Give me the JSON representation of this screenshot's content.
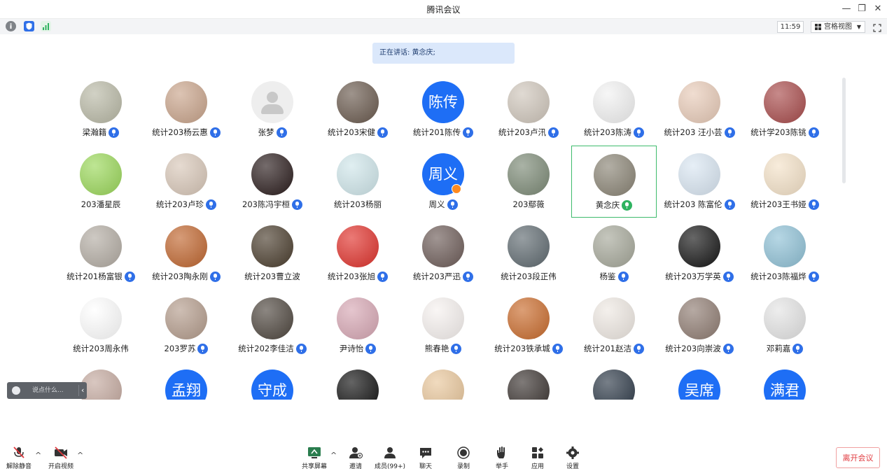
{
  "window": {
    "title": "腾讯会议",
    "minimize": "—",
    "restore": "❐",
    "close": "✕"
  },
  "toolbar": {
    "time": "11:59",
    "view_mode": "宫格视图",
    "caret": "▼"
  },
  "banner": {
    "speaking_text": "正在讲话: 黄念庆;"
  },
  "chat": {
    "placeholder": "说点什么...",
    "arrow": "‹"
  },
  "participants": [
    {
      "name": "梁瀚籍",
      "avatar": "photo",
      "color": "#b9b9a6",
      "mic": "on"
    },
    {
      "name": "统计203杨云惠",
      "avatar": "photo",
      "color": "#c9a48b",
      "mic": "on"
    },
    {
      "name": "张梦",
      "avatar": "default",
      "color": "#eeeeee",
      "mic": "on"
    },
    {
      "name": "统计203宋健",
      "avatar": "photo",
      "color": "#6a5a4e",
      "mic": "on"
    },
    {
      "name": "统计201陈传",
      "avatar": "text",
      "text": "陈传",
      "mic": "on"
    },
    {
      "name": "统计203卢汛",
      "avatar": "photo",
      "color": "#cfc6bb",
      "mic": "on"
    },
    {
      "name": "统计203陈涛",
      "avatar": "photo",
      "color": "#f2f2f2",
      "mic": "on"
    },
    {
      "name": "统计203 汪小芸",
      "avatar": "photo",
      "color": "#e8cbb8",
      "mic": "on"
    },
    {
      "name": "统计学203陈铫",
      "avatar": "photo",
      "color": "#a84b4b",
      "mic": "on"
    },
    {
      "name": "203潘星辰",
      "avatar": "photo",
      "color": "#9bd85a",
      "mic": "none"
    },
    {
      "name": "统计203卢珍",
      "avatar": "photo",
      "color": "#d8c7b8",
      "mic": "on"
    },
    {
      "name": "203陈冯宇桓",
      "avatar": "photo",
      "color": "#2a1c1c",
      "mic": "on"
    },
    {
      "name": "统计203杨丽",
      "avatar": "photo",
      "color": "#cfe6ea",
      "mic": "none"
    },
    {
      "name": "周义",
      "avatar": "text",
      "text": "周义",
      "mic": "on",
      "badge": true
    },
    {
      "name": "203鄢薇",
      "avatar": "photo",
      "color": "#7c8a76",
      "mic": "none"
    },
    {
      "name": "黄念庆",
      "avatar": "photo",
      "color": "#8a8475",
      "mic": "talking",
      "active": true
    },
    {
      "name": "统计203 陈富伦",
      "avatar": "photo",
      "color": "#d9e6f2",
      "mic": "on"
    },
    {
      "name": "统计203王书娅",
      "avatar": "photo",
      "color": "#f4e2c8",
      "mic": "on"
    },
    {
      "name": "统计201杨富银",
      "avatar": "photo",
      "color": "#b3aca3",
      "mic": "on"
    },
    {
      "name": "统计203陶永刚",
      "avatar": "photo",
      "color": "#c0662f",
      "mic": "on"
    },
    {
      "name": "统计203曹立波",
      "avatar": "photo",
      "color": "#4a3d2d",
      "mic": "none"
    },
    {
      "name": "统计203张旭",
      "avatar": "photo",
      "color": "#e0322c",
      "mic": "on"
    },
    {
      "name": "统计203严迅",
      "avatar": "photo",
      "color": "#6d5c58",
      "mic": "on"
    },
    {
      "name": "统计203段正伟",
      "avatar": "photo",
      "color": "#5f6a70",
      "mic": "none"
    },
    {
      "name": "杨鉴",
      "avatar": "photo",
      "color": "#a6a89a",
      "mic": "on"
    },
    {
      "name": "统计203万学英",
      "avatar": "photo",
      "color": "#151515",
      "mic": "on"
    },
    {
      "name": "统计203陈福烨",
      "avatar": "photo",
      "color": "#8fc1d6",
      "mic": "on"
    },
    {
      "name": "统计203周永伟",
      "avatar": "blank",
      "color": "#ffffff",
      "mic": "none"
    },
    {
      "name": "203罗苏",
      "avatar": "photo",
      "color": "#b49c8c",
      "mic": "on"
    },
    {
      "name": "统计202李佳洁",
      "avatar": "photo",
      "color": "#4e463e",
      "mic": "on"
    },
    {
      "name": "尹诗怡",
      "avatar": "photo",
      "color": "#d7a7b4",
      "mic": "on"
    },
    {
      "name": "熊春艳",
      "avatar": "photo",
      "color": "#f6f1ef",
      "mic": "on"
    },
    {
      "name": "统计203铁承城",
      "avatar": "photo",
      "color": "#c96b2c",
      "mic": "on"
    },
    {
      "name": "统计201赵洁",
      "avatar": "photo",
      "color": "#eee8e2",
      "mic": "on"
    },
    {
      "name": "统计203向崇波",
      "avatar": "photo",
      "color": "#8f7c72",
      "mic": "on"
    },
    {
      "name": "邓莉嘉",
      "avatar": "photo",
      "color": "#e4e4e4",
      "mic": "on"
    },
    {
      "name": "",
      "avatar": "photo",
      "color": "#c4a99f",
      "mic": "none"
    },
    {
      "name": "",
      "avatar": "text",
      "text": "孟翔",
      "mic": "none"
    },
    {
      "name": "",
      "avatar": "text",
      "text": "守成",
      "mic": "none"
    },
    {
      "name": "",
      "avatar": "photo",
      "color": "#111111",
      "mic": "none"
    },
    {
      "name": "",
      "avatar": "photo",
      "color": "#e9c79c",
      "mic": "none"
    },
    {
      "name": "",
      "avatar": "photo",
      "color": "#3a3330",
      "mic": "none"
    },
    {
      "name": "",
      "avatar": "photo",
      "color": "#2e3a48",
      "mic": "none"
    },
    {
      "name": "",
      "avatar": "text",
      "text": "吴席",
      "mic": "none"
    },
    {
      "name": "",
      "avatar": "text",
      "text": "满君",
      "mic": "none"
    }
  ],
  "bottombar": {
    "unmute": "解除静音",
    "start_video": "开启视频",
    "share_screen": "共享屏幕",
    "invite": "邀请",
    "members": "成员(99+)",
    "chat": "聊天",
    "record": "录制",
    "raise_hand": "举手",
    "apps": "应用",
    "settings": "设置",
    "caret": "^",
    "leave": "离开会议"
  },
  "colors": {
    "accent": "#1e6ef5",
    "active_border": "#3dbb6c",
    "talking": "#2fb360",
    "leave": "#e0393e"
  }
}
